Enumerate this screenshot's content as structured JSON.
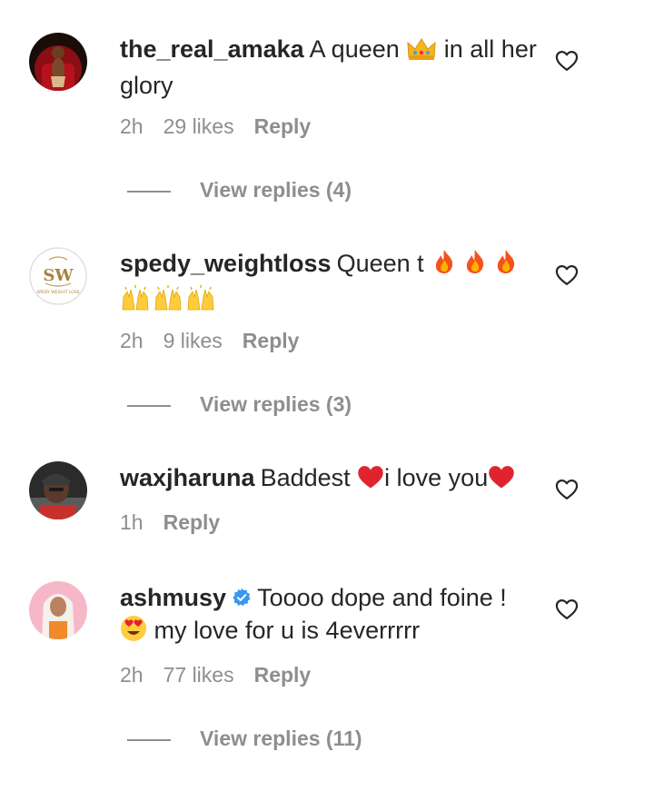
{
  "comments": [
    {
      "username": "the_real_amaka",
      "text_before": "A queen ",
      "text_after": " in all her glory",
      "time": "2h",
      "likes": "29 likes",
      "reply_label": "Reply",
      "view_replies": "View replies (4)"
    },
    {
      "username": "spedy_weightloss",
      "text_before": "Queen t ",
      "time": "2h",
      "likes": "9 likes",
      "reply_label": "Reply",
      "view_replies": "View replies (3)",
      "avatar_logo_text": "SPEDY WEIGHT LOSS"
    },
    {
      "username": "waxjharuna",
      "text_before": "Baddest ",
      "text_mid": "i love you",
      "time": "1h",
      "reply_label": "Reply"
    },
    {
      "username": "ashmusy",
      "verified": true,
      "line1": "Toooo dope and foine !",
      "line2": " my love for u is 4everrrrr",
      "time": "2h",
      "likes": "77 likes",
      "reply_label": "Reply",
      "view_replies": "View replies (11)"
    }
  ],
  "colors": {
    "text": "#262626",
    "secondary": "#8e8e8e",
    "verified": "#3897f0",
    "heart_red": "#e0242f"
  }
}
